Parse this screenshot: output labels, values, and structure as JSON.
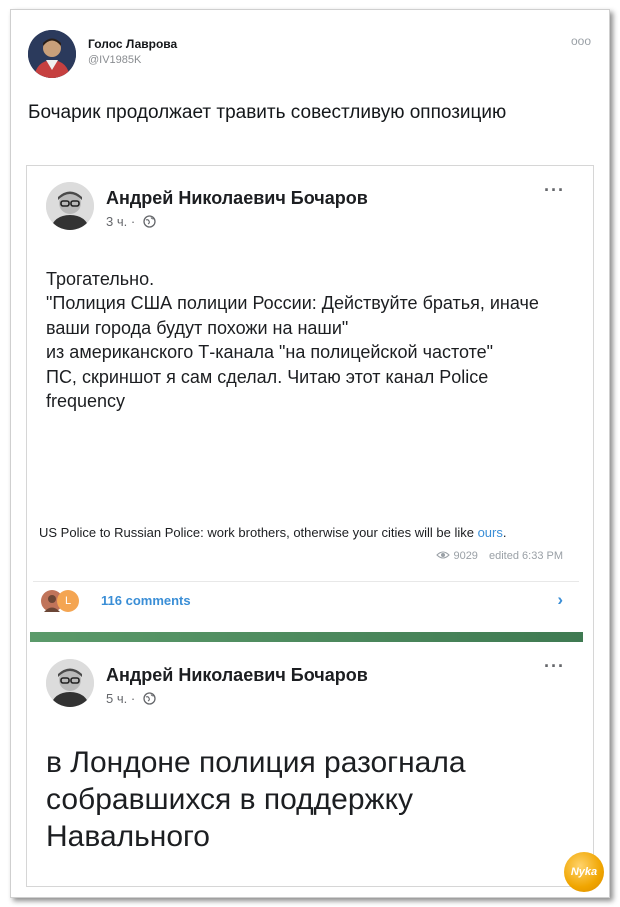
{
  "tweet": {
    "author_name": "Голос Лаврова",
    "author_handle": "@IV1985K",
    "more_label": "ooo",
    "text": "Бочарик продолжает травить совестливую оппозицию"
  },
  "fb_post_1": {
    "author_name": "Андрей Николаевич Бочаров",
    "time": "3 ч. ·",
    "more_label": "···",
    "text": "Трогательно.\n\"Полиция США полиции России:  Действуйте братья, иначе ваши города будут похожи на наши\"\nиз американского Т-канала \"на полицейской частоте\"\nПС, скриншот я сам сделал. Читаю этот канал Police frequency",
    "telegram": {
      "message_main": "US Police to Russian Police: work brothers, otherwise your cities will be like ",
      "message_link": "ours",
      "message_end": ".",
      "views": "9029",
      "edited": "edited 6:33 PM",
      "avatar_letter": "L",
      "comments": "116 comments"
    }
  },
  "fb_post_2": {
    "author_name": "Андрей Николаевич Бочаров",
    "time": "5 ч. ·",
    "more_label": "···",
    "text": "в Лондоне полиция разогнала собравшихся в поддержку Навального"
  },
  "watermark": {
    "logo_text": "Nyka"
  },
  "colors": {
    "accent_link": "#3a8ed6",
    "meta_gray": "#65676b",
    "telegram_green": "#4b8a5e"
  }
}
